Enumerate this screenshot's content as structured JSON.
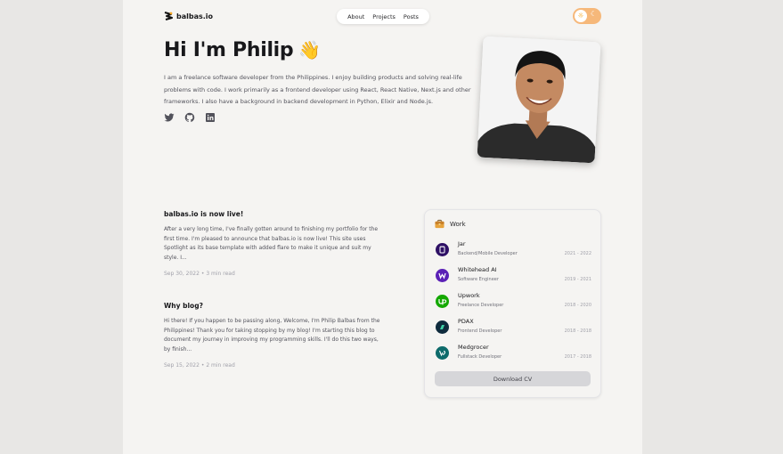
{
  "header": {
    "logo_text": "balbas.io",
    "nav": [
      "About",
      "Projects",
      "Posts"
    ]
  },
  "hero": {
    "title": "Hi I'm Philip",
    "emoji": "👋",
    "text": "I am a freelance software developer from the Philippines. I enjoy building products and solving real-life problems with code. I work primarily as a frontend developer using React, React Native, Next.js and other frameworks. I also have a background in backend development in Python, Elixir and Node.js.",
    "socials": [
      "twitter-icon",
      "github-icon",
      "linkedin-icon"
    ]
  },
  "posts": [
    {
      "title": "balbas.io is now live!",
      "excerpt": "After a very long time, I've finally gotten around to finishing my portfolio for the first time. I'm pleased to announce that balbas.io is now live! This site uses Spotlight as its base template with added flare to make it unique and suit my style. I...",
      "date": "Sep 30, 2022",
      "read": "3 min read"
    },
    {
      "title": "Why blog?",
      "excerpt": "Hi there! If you happen to be passing along, Welcome, I'm Philip Balbas from the Philippines! Thank you for taking stopping by my blog! I'm starting this blog to document my journey in improving my programming skills. I'll do this two ways, by finish...",
      "date": "Sep 15, 2022",
      "read": "2 min read"
    }
  ],
  "work": {
    "title": "Work",
    "jobs": [
      {
        "company": "Jar",
        "role": "Backend/Mobile Developer",
        "dates": "2021 - 2022",
        "color": "#2e1065",
        "icon": "jar-logo"
      },
      {
        "company": "Whitehead AI",
        "role": "Software Engineer",
        "dates": "2019 - 2021",
        "color": "#5b21b6",
        "icon": "whitehead-logo"
      },
      {
        "company": "Upwork",
        "role": "Freelance Developer",
        "dates": "2018 - 2020",
        "color": "#14a800",
        "icon": "upwork-logo"
      },
      {
        "company": "PDAX",
        "role": "Frontend Developer",
        "dates": "2018 - 2018",
        "color": "#0f2b3d",
        "icon": "pdax-logo"
      },
      {
        "company": "Medgrocer",
        "role": "Fullstack Developer",
        "dates": "2017 - 2018",
        "color": "#0e6b6b",
        "icon": "medgrocer-logo"
      }
    ],
    "cv_label": "Download CV"
  },
  "colors": {
    "accent": "#f6b87a",
    "page_bg": "#f5f4f2"
  }
}
